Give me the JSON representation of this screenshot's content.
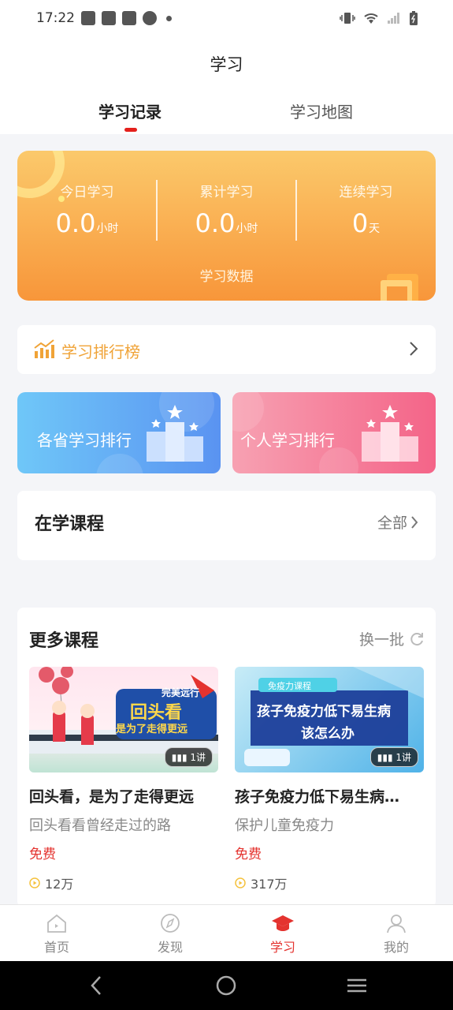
{
  "status_bar": {
    "time": "17:22"
  },
  "header": {
    "title": "学习",
    "tabs": [
      {
        "label": "学习记录",
        "active": true
      },
      {
        "label": "学习地图",
        "active": false
      }
    ]
  },
  "stats": {
    "items": [
      {
        "label": "今日学习",
        "value": "0.0",
        "unit": "小时"
      },
      {
        "label": "累计学习",
        "value": "0.0",
        "unit": "小时"
      },
      {
        "label": "连续学习",
        "value": "0",
        "unit": "天"
      }
    ],
    "link_label": "学习数据"
  },
  "ranking": {
    "label": "学习排行榜",
    "cards": [
      {
        "label": "各省学习排行"
      },
      {
        "label": "个人学习排行"
      }
    ]
  },
  "learning_courses": {
    "title": "在学课程",
    "all_label": "全部"
  },
  "more_courses": {
    "title": "更多课程",
    "refresh_label": "换一批",
    "items": [
      {
        "title": "回头看，是为了走得更远",
        "subtitle": "回头看看曾经走过的路",
        "price": "免费",
        "views": "12万",
        "lessons": "1讲",
        "thumb_text_1": "回头看",
        "thumb_text_2": "是为了走得更远",
        "thumb_tag": "完美远行"
      },
      {
        "title": "孩子免疫力低下易生病…",
        "subtitle": "保护儿童免疫力",
        "price": "免费",
        "views": "317万",
        "lessons": "1讲",
        "thumb_text_1": "孩子免疫力低下易生病",
        "thumb_text_2": "该怎么办",
        "thumb_tag": "免疫力课程"
      }
    ]
  },
  "tabbar": {
    "items": [
      {
        "label": "首页",
        "icon": "home-icon",
        "active": false
      },
      {
        "label": "发现",
        "icon": "compass-icon",
        "active": false
      },
      {
        "label": "学习",
        "icon": "graduation-cap-icon",
        "active": true
      },
      {
        "label": "我的",
        "icon": "user-icon",
        "active": false
      }
    ]
  },
  "colors": {
    "accent": "#e4332f",
    "rank_gold": "#f0a337",
    "stats_top": "#fbc96b",
    "stats_bottom": "#f8963a"
  }
}
